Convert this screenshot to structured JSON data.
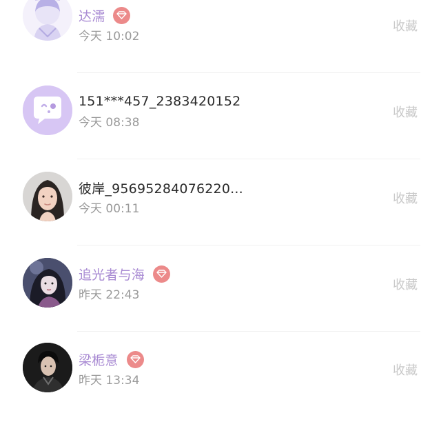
{
  "visitors": [
    {
      "name": "达濡",
      "time": "今天 10:02",
      "vip": true,
      "action": "收藏",
      "avatar": "anime-girl-avatar"
    },
    {
      "name": "151***457_2383420152",
      "time": "今天 08:38",
      "vip": false,
      "action": "收藏",
      "avatar": "default-chat-bubble-avatar"
    },
    {
      "name": "彼岸_95695284076220...",
      "time": "今天 00:11",
      "vip": false,
      "action": "收藏",
      "avatar": "woman-portrait-avatar"
    },
    {
      "name": "追光者与海",
      "time": "昨天 22:43",
      "vip": true,
      "action": "收藏",
      "avatar": "anime-character-avatar"
    },
    {
      "name": "梁栀意",
      "time": "昨天 13:34",
      "vip": true,
      "action": "收藏",
      "avatar": "man-portrait-avatar"
    }
  ],
  "colors": {
    "vip_name": "#a98bd3",
    "normal_name": "#2b2b2b",
    "time": "#9a9a9a",
    "action": "#c9c9c9",
    "vip_badge": "#ec8a8a"
  },
  "icons": {
    "vip_badge": "diamond-icon"
  }
}
